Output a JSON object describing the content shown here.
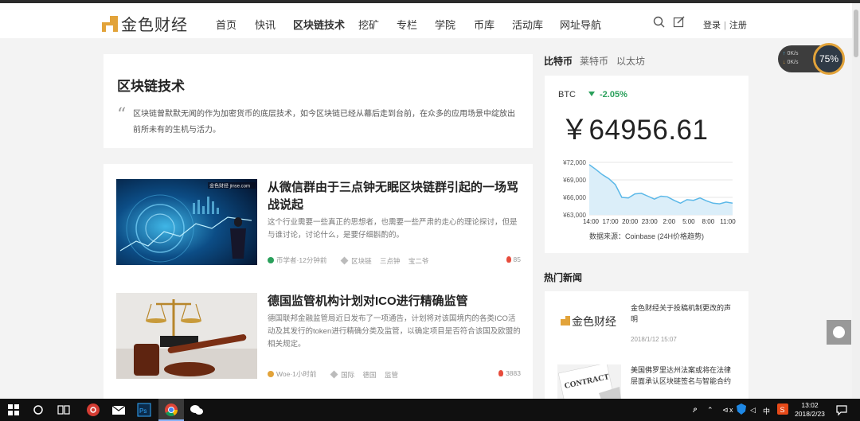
{
  "header": {
    "logo_text": "金色财经",
    "nav": [
      "首页",
      "快讯",
      "区块链技术",
      "挖矿",
      "专栏",
      "学院",
      "币库",
      "活动库",
      "网址导航"
    ],
    "active_nav": "区块链技术",
    "login": "登录",
    "separator": "|",
    "register": "注册"
  },
  "intro": {
    "title": "区块链技术",
    "quote": "“",
    "text": "区块链曾默默无闻的作为加密货币的底层技术，如今区块链已经从幕后走到台前，在众多的应用场景中绽放出前所未有的生机与活力。"
  },
  "articles": [
    {
      "title": "从微信群由于三点钟无眠区块链群引起的一场骂战说起",
      "summary": "这个行业需要一些真正的思想者，也需要一些严肃的走心的理论探讨，但是与谁讨论，讨论什么，是要仔细斟酌的。",
      "thumb_caption": "金色财经 jinse.com",
      "author": "币学者",
      "time": "12分钟前",
      "tags": [
        "区块链",
        "三点钟",
        "宝二爷"
      ],
      "hot": "85"
    },
    {
      "title": "德国监管机构计划对ICO进行精确监管",
      "summary": "德国联邦金融监管局近日发布了一项通告，计划将对该国境内的各类ICO活动及其发行的token进行精确分类及监管，以确定项目是否符合该国及欧盟的相关规定。",
      "author": "Woe",
      "time": "1小时前",
      "tags": [
        "国际",
        "德国",
        "监管"
      ],
      "hot": "3883"
    }
  ],
  "sidebar": {
    "tabs": [
      "比特币",
      "莱特币",
      "以太坊"
    ],
    "active_tab": "比特币",
    "coin": "BTC",
    "change": "-2.05%",
    "price": "￥64956.61",
    "source": "数据来源：Coinbase (24H价格趋势)",
    "hot_title": "热门新闻",
    "news": [
      {
        "title": "金色财经关于投稿机制更改的声明",
        "date": "2018/1/12 15:07",
        "image_text": "金色财经"
      },
      {
        "title": "美国佛罗里达州法案或将在法律层面承认区块链签名与智能合约",
        "date": "",
        "image_text": "CONTRACT"
      }
    ]
  },
  "chart_data": {
    "type": "line",
    "x": [
      "14:00",
      "17:00",
      "20:00",
      "23:00",
      "2:00",
      "5:00",
      "8:00",
      "11:00"
    ],
    "values": [
      71600,
      70800,
      69900,
      69200,
      68200,
      66000,
      65900,
      66600,
      66700,
      66200,
      65700,
      66200,
      66100,
      65500,
      65000,
      65600,
      65500,
      65900,
      65400,
      65000,
      64900,
      65200,
      65000
    ],
    "ylabels": [
      "¥72,000",
      "¥69,000",
      "¥66,000",
      "¥63,000"
    ],
    "ylim": [
      63000,
      72000
    ],
    "grid": true,
    "color": "#5bb8e8",
    "fill": "#dbeef9"
  },
  "widget": {
    "up": "0K/s",
    "down": "0K/s",
    "percent": "75%"
  },
  "taskbar": {
    "time": "13:02",
    "date": "2018/2/23",
    "ime": "中",
    "tray_a": "x",
    "tray_b": "⊲"
  }
}
